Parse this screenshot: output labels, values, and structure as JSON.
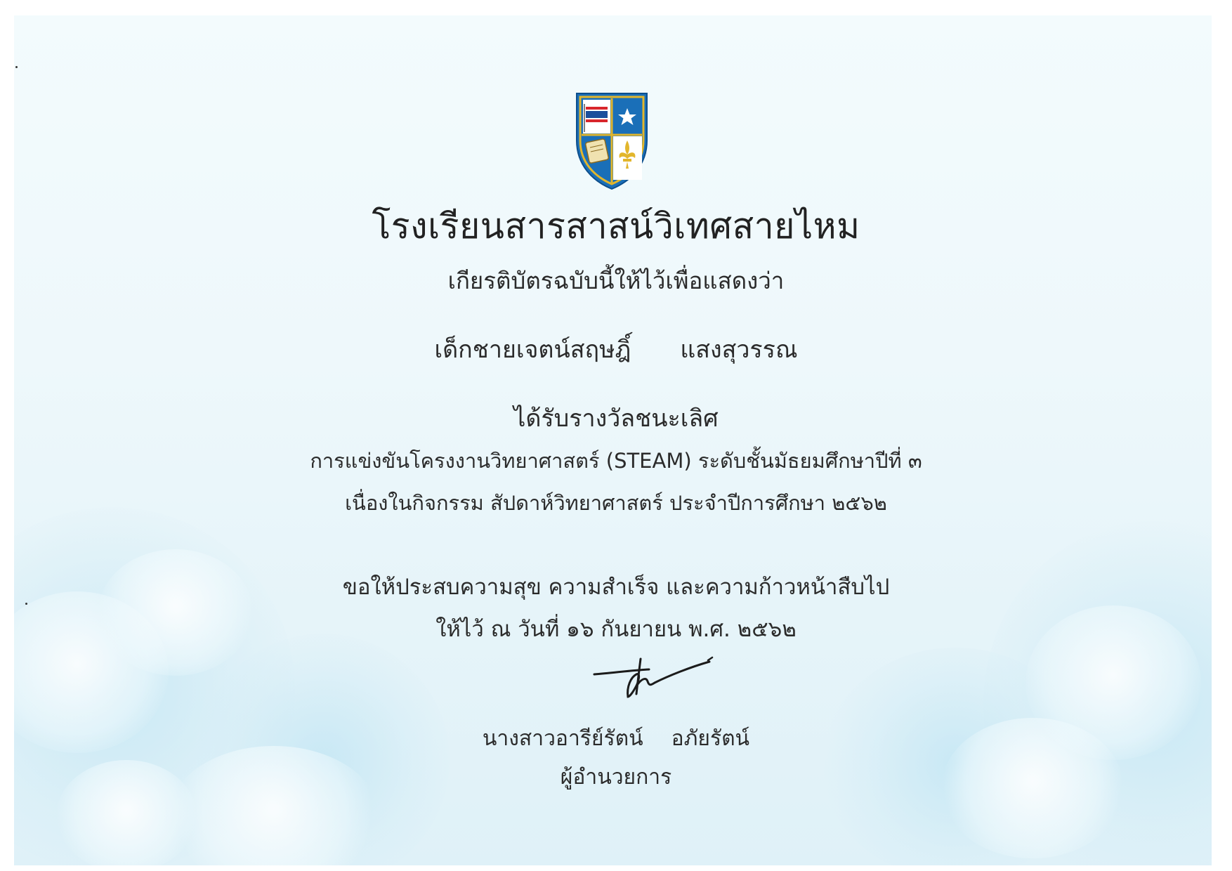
{
  "school": {
    "name": "โรงเรียนสารสาสน์วิเทศสายไหม",
    "crest_icon": "school-crest-shield"
  },
  "certificate": {
    "intro": "เกียรติบัตรฉบับนี้ให้ไว้เพื่อแสดงว่า",
    "recipient_first": "เด็กชายเจตน์สฤษฎิ์",
    "recipient_last": "แสงสุวรรณ",
    "award": "ได้รับรางวัลชนะเลิศ",
    "competition_line1": "การแข่งขันโครงงานวิทยาศาสตร์ (STEAM) ระดับชั้นมัธยมศึกษาปีที่ ๓",
    "competition_line2": "เนื่องในกิจกรรม สัปดาห์วิทยาศาสตร์ ประจำปีการศึกษา  ๒๕๖๒",
    "wish": "ขอให้ประสบความสุข  ความสำเร็จ และความก้าวหน้าสืบไป",
    "given_date": "ให้ไว้ ณ วันที่  ๑๖  กันยายน  พ.ศ.  ๒๕๖๒"
  },
  "signatory": {
    "first_name": "นางสาวอารีย์รัตน์",
    "last_name": "อภัยรัตน์",
    "position": "ผู้อำนวยการ"
  },
  "colors": {
    "crest_blue": "#1a6fb8",
    "crest_gold": "#e2b62c",
    "crest_red": "#d8262c",
    "background": "#eef8fb"
  }
}
